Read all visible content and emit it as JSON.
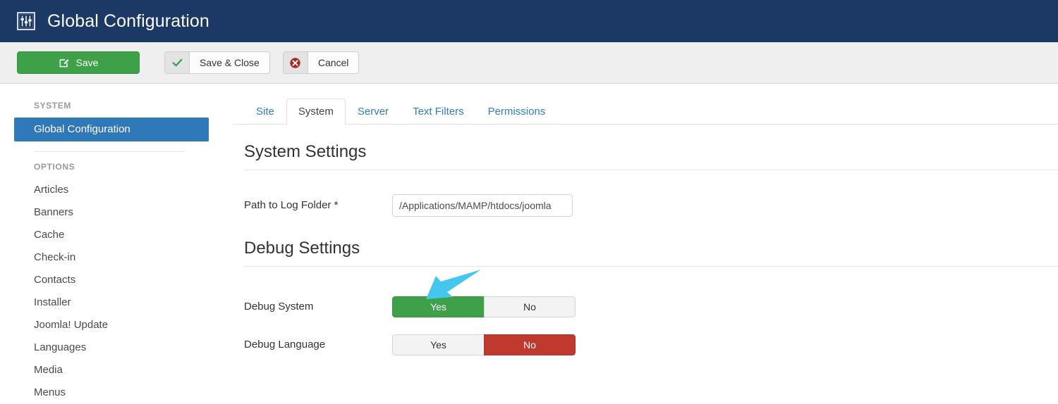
{
  "header": {
    "title": "Global Configuration",
    "icon": "sliders-icon",
    "background_color": "#1c3864"
  },
  "toolbar": {
    "buttons": [
      {
        "label": "Save",
        "icon": "edit-square-icon",
        "style": "primary-green",
        "color": "#3ea14a"
      },
      {
        "label": "Save & Close",
        "icon": "check-icon",
        "style": "default"
      },
      {
        "label": "Cancel",
        "icon": "cancel-circle-icon",
        "style": "default"
      }
    ]
  },
  "sidebar": {
    "groups": [
      {
        "heading": "SYSTEM",
        "items": [
          {
            "label": "Global Configuration",
            "active": true
          }
        ]
      },
      {
        "heading": "OPTIONS",
        "items": [
          {
            "label": "Articles",
            "active": false
          },
          {
            "label": "Banners",
            "active": false
          },
          {
            "label": "Cache",
            "active": false
          },
          {
            "label": "Check-in",
            "active": false
          },
          {
            "label": "Contacts",
            "active": false
          },
          {
            "label": "Installer",
            "active": false
          },
          {
            "label": "Joomla! Update",
            "active": false
          },
          {
            "label": "Languages",
            "active": false
          },
          {
            "label": "Media",
            "active": false
          },
          {
            "label": "Menus",
            "active": false
          }
        ]
      }
    ],
    "active_color": "#2f78b9"
  },
  "tabs": [
    {
      "label": "Site",
      "active": false
    },
    {
      "label": "System",
      "active": true
    },
    {
      "label": "Server",
      "active": false
    },
    {
      "label": "Text Filters",
      "active": false
    },
    {
      "label": "Permissions",
      "active": false
    }
  ],
  "sections": [
    {
      "title": "System Settings",
      "fields": [
        {
          "label": "Path to Log Folder *",
          "type": "text",
          "value": "/Applications/MAMP/htdocs/joomla",
          "placeholder": ""
        }
      ]
    },
    {
      "title": "Debug Settings",
      "fields": [
        {
          "label": "Debug System",
          "type": "toggle",
          "options": [
            "Yes",
            "No"
          ],
          "selected": "Yes"
        },
        {
          "label": "Debug Language",
          "type": "toggle",
          "options": [
            "Yes",
            "No"
          ],
          "selected": "No"
        }
      ]
    }
  ],
  "annotation": {
    "type": "arrow",
    "color": "#45c6ee",
    "points_to": "debug-system-yes-option",
    "direction": "down-left"
  }
}
